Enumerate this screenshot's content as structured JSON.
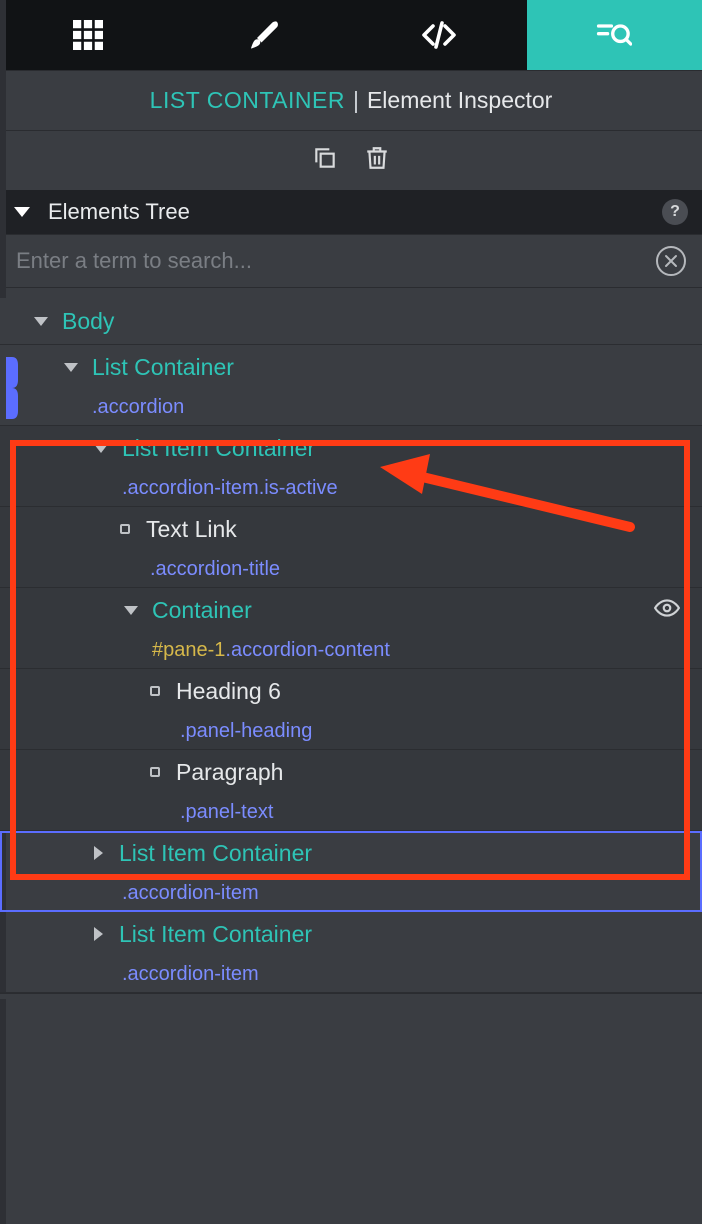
{
  "tabs": {
    "grid_icon": "grid-icon",
    "brush_icon": "brush-icon",
    "code_icon": "code-icon",
    "inspect_icon": "inspect-icon"
  },
  "breadcrumb": {
    "element": "LIST CONTAINER",
    "separator": "|",
    "title": "Element Inspector"
  },
  "section": {
    "title": "Elements Tree",
    "help": "?"
  },
  "search": {
    "placeholder": "Enter a term to search..."
  },
  "tree": {
    "body": {
      "label": "Body"
    },
    "list_container": {
      "label": "List Container",
      "class": ".accordion"
    },
    "item_active": {
      "label": "List Item Container",
      "class": ".accordion-item.is-active"
    },
    "text_link": {
      "label": "Text Link",
      "class": ".accordion-title"
    },
    "container": {
      "label": "Container",
      "id": "#pane-1",
      "class": ".accordion-content"
    },
    "heading6": {
      "label": "Heading 6",
      "class": ".panel-heading"
    },
    "paragraph": {
      "label": "Paragraph",
      "class": ".panel-text"
    },
    "item2": {
      "label": "List Item Container",
      "class": ".accordion-item"
    },
    "item3": {
      "label": "List Item Container",
      "class": ".accordion-item"
    }
  }
}
